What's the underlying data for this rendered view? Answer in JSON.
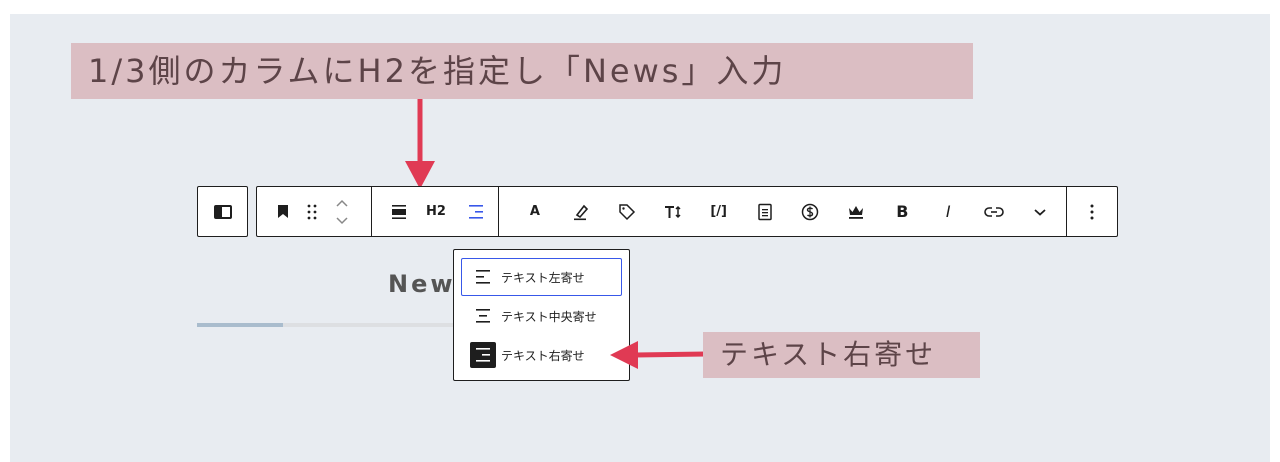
{
  "annotations": {
    "top_text": "1/3側のカラムにH2を指定し「News」入力",
    "right_text": "テキスト右寄せ"
  },
  "toolbar": {
    "heading_level": "H2",
    "text_style_label": "A",
    "clear_format_label": "[/]",
    "bold_label": "B",
    "italic_label": "I"
  },
  "heading": {
    "text": "New"
  },
  "alignment_menu": {
    "items": [
      {
        "label": "テキスト左寄せ",
        "state": "focused"
      },
      {
        "label": "テキスト中央寄せ",
        "state": "normal"
      },
      {
        "label": "テキスト右寄せ",
        "state": "active"
      }
    ]
  },
  "colors": {
    "annotation_bg": "#dbbec3",
    "annotation_text": "#5d4448",
    "arrow": "#e03a54",
    "accent": "#3858e9",
    "canvas_bg": "#e8ecf1",
    "underline_accent": "#a9bccd"
  }
}
